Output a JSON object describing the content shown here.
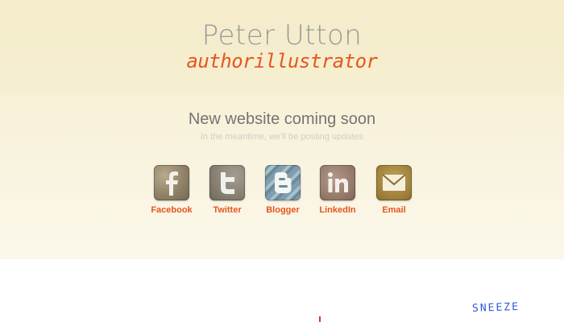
{
  "header": {
    "title": "Peter Utton",
    "subtitle": "authorillustrator"
  },
  "main": {
    "headline": "New website coming soon",
    "tagline": "In the meantime, we'll be posting updates"
  },
  "social": {
    "items": [
      {
        "label": "Facebook",
        "icon": "facebook-icon"
      },
      {
        "label": "Twitter",
        "icon": "twitter-icon"
      },
      {
        "label": "Blogger",
        "icon": "blogger-icon"
      },
      {
        "label": "LinkedIn",
        "icon": "linkedin-icon"
      },
      {
        "label": "Email",
        "icon": "email-icon"
      }
    ]
  },
  "footer": {
    "doodle_text": "SNEEZE"
  },
  "colors": {
    "accent": "#e5561f",
    "title": "#9a9a9a",
    "headline": "#747474",
    "tagline": "#cfcfc4"
  }
}
